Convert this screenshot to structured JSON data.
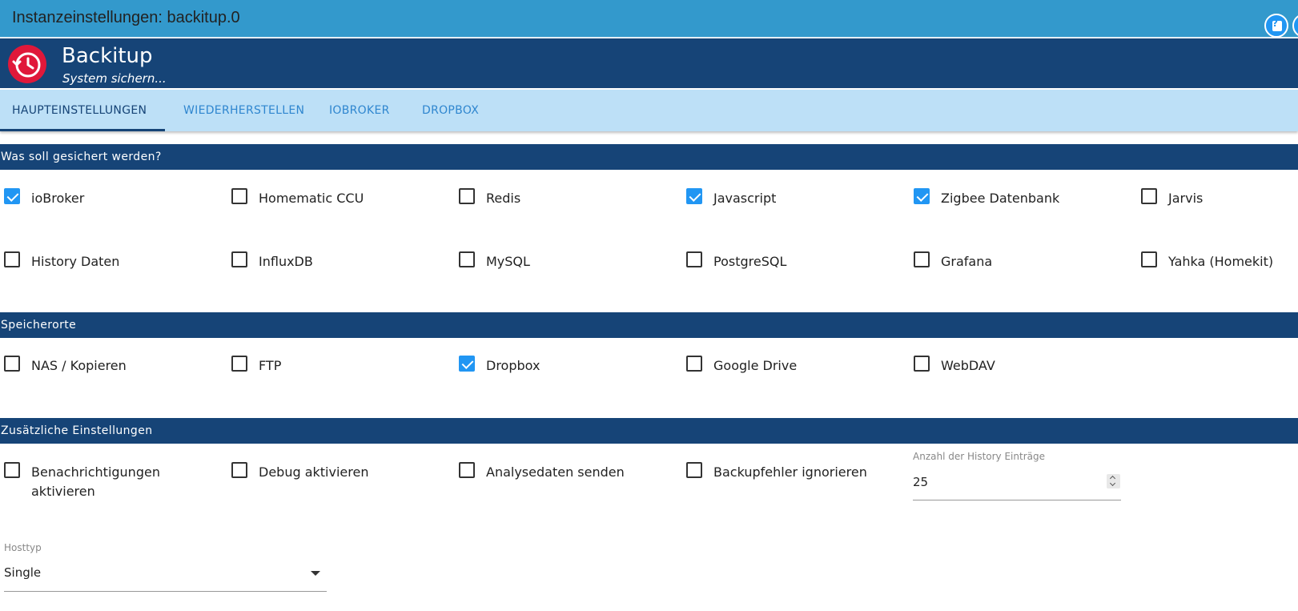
{
  "window": {
    "title": "Instanzeinstellungen: backitup.0"
  },
  "app": {
    "name": "Backitup",
    "subtitle": "System sichern...",
    "logo_icon": "clock-history-icon",
    "help_icon": "help-icon"
  },
  "tabs": [
    {
      "label": "HAUPTEINSTELLUNGEN",
      "active": true
    },
    {
      "label": "WIEDERHERSTELLEN",
      "active": false
    },
    {
      "label": "IOBROKER",
      "active": false
    },
    {
      "label": "DROPBOX",
      "active": false
    }
  ],
  "sections": {
    "backup": {
      "title": "Was soll gesichert werden?",
      "items": [
        {
          "label": "ioBroker",
          "checked": true
        },
        {
          "label": "Homematic CCU",
          "checked": false
        },
        {
          "label": "Redis",
          "checked": false
        },
        {
          "label": "Javascript",
          "checked": true
        },
        {
          "label": "Zigbee Datenbank",
          "checked": true
        },
        {
          "label": "Jarvis",
          "checked": false
        },
        {
          "label": "History Daten",
          "checked": false
        },
        {
          "label": "InfluxDB",
          "checked": false
        },
        {
          "label": "MySQL",
          "checked": false
        },
        {
          "label": "PostgreSQL",
          "checked": false
        },
        {
          "label": "Grafana",
          "checked": false
        },
        {
          "label": "Yahka (Homekit)",
          "checked": false
        }
      ]
    },
    "storage": {
      "title": "Speicherorte",
      "items": [
        {
          "label": "NAS / Kopieren",
          "checked": false
        },
        {
          "label": "FTP",
          "checked": false
        },
        {
          "label": "Dropbox",
          "checked": true
        },
        {
          "label": "Google Drive",
          "checked": false
        },
        {
          "label": "WebDAV",
          "checked": false
        }
      ]
    },
    "extra": {
      "title": "Zusätzliche Einstellungen",
      "items": [
        {
          "label": "Benachrichtigungen aktivieren",
          "checked": false
        },
        {
          "label": "Debug aktivieren",
          "checked": false
        },
        {
          "label": "Analysedaten senden",
          "checked": false
        },
        {
          "label": "Backupfehler ignorieren",
          "checked": false
        }
      ],
      "history": {
        "label": "Anzahl der History Einträge",
        "value": "25"
      },
      "hosttype": {
        "label": "Hosttyp",
        "value": "Single"
      }
    }
  },
  "colors": {
    "accent": "#2196f3",
    "header": "#164477",
    "titlebar": "#3399cc",
    "tabbar": "#bde0f7",
    "logo": "#e0183a"
  }
}
